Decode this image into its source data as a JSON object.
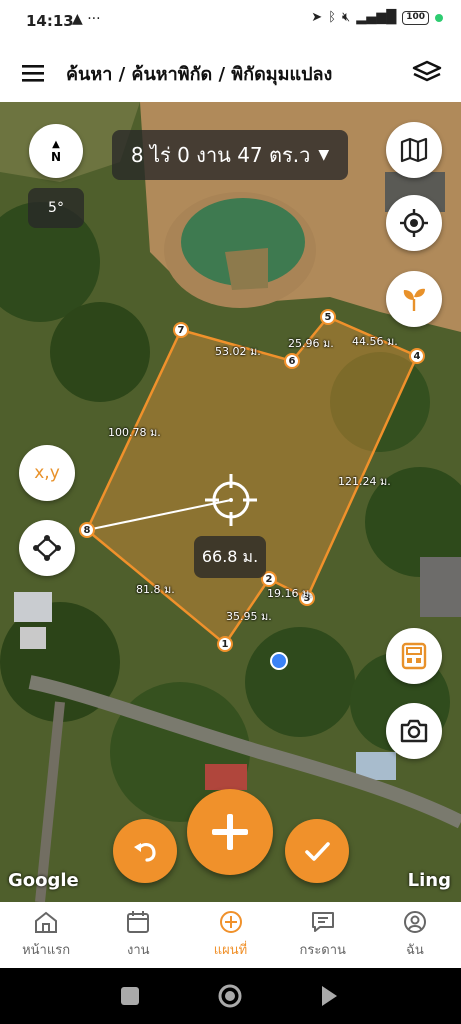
{
  "status": {
    "time": "14:13",
    "battery": "100"
  },
  "appbar": {
    "title": "ค้นหา / ค้นหาพิกัด / พิกัดมุมแปลง"
  },
  "map": {
    "area": "8 ไร่ 0 งาน 47 ตร.ว",
    "compass_letter": "N",
    "rotation": "5°",
    "xy_label": "x,y",
    "measure": "66.8 ม.",
    "google": "Google",
    "ling": "Ling",
    "vertices": [
      "1",
      "2",
      "3",
      "4",
      "5",
      "6",
      "7",
      "8"
    ],
    "edges": [
      "19.16 ม.",
      "35.95 ม.",
      "81.8 ม.",
      "100.78 ม.",
      "53.02 ม.",
      "25.96 ม.",
      "44.56 ม.",
      "121.24 ม."
    ]
  },
  "nav": {
    "home": "หน้าแรก",
    "work": "งาน",
    "map": "แผนที่",
    "board": "กระดาน",
    "me": "ฉัน"
  },
  "colors": {
    "accent": "#f0912b"
  }
}
